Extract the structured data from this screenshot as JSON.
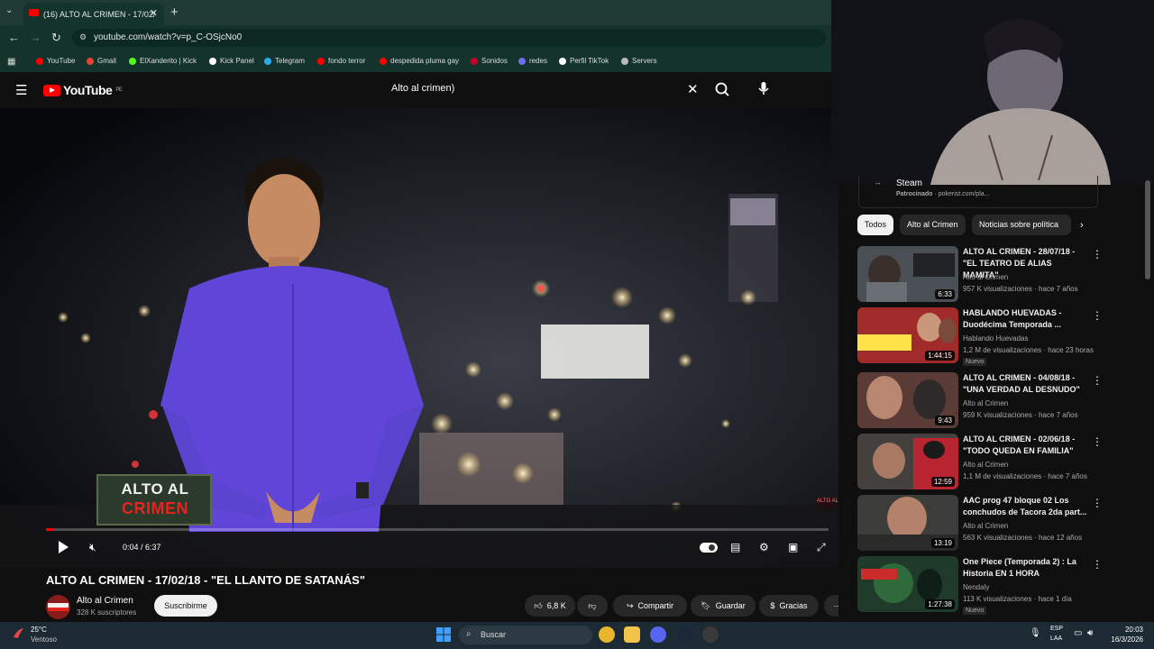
{
  "browser": {
    "tab_title": "(16) ALTO AL CRIMEN - 17/02/",
    "url": "youtube.com/watch?v=p_C-OSjcNo0",
    "bookmarks": [
      {
        "label": "YouTube",
        "color": "#ff0000"
      },
      {
        "label": "Gmail",
        "color": "#ea4335"
      },
      {
        "label": "ElXanderito | Kick",
        "color": "#53fc18"
      },
      {
        "label": "Kick Panel",
        "color": "#ffffff"
      },
      {
        "label": "Telegram",
        "color": "#2aabee"
      },
      {
        "label": "fondo terror",
        "color": "#ff0000"
      },
      {
        "label": "despedida pluma gay",
        "color": "#ff0000"
      },
      {
        "label": "Sonidos",
        "color": "#c4002b"
      },
      {
        "label": "redes",
        "color": "#6f6cf0"
      },
      {
        "label": "Perfil TikTok",
        "color": "#ffffff"
      },
      {
        "label": "Servers",
        "color": "#bbbbbb"
      }
    ]
  },
  "youtube": {
    "logo_text": "YouTube",
    "region": "PE",
    "search_value": "Alto al crimen)"
  },
  "player": {
    "time": "0:04 / 6:37",
    "progress": 0.01,
    "overlay_logo_line1": "ALTO AL",
    "overlay_logo_line2": "CRIMEN",
    "watermark": "ALTO AL"
  },
  "video": {
    "title": "ALTO AL CRIMEN - 17/02/18 - \"EL LLANTO DE SATANÁS\"",
    "channel": "Alto al Crimen",
    "subscribers": "328 K suscriptores",
    "subscribe_label": "Suscribirme",
    "likes": "6,8 K",
    "share_label": "Compartir",
    "save_label": "Guardar",
    "thanks_label": "Gracias"
  },
  "sidebar": {
    "ad": {
      "title": "Steam",
      "sponsor_label": "Patrocinado",
      "sponsor_url": "pokerist.com/pla..."
    },
    "chips": [
      "Todos",
      "Alto al Crimen",
      "Noticias sobre política"
    ],
    "recommendations": [
      {
        "title": "ALTO AL CRIMEN - 28/07/18 - \"EL TEATRO DE ALIAS MAMITA\"",
        "channel": "Alto al Crimen",
        "meta": "957 K visualizaciones · hace 7 años",
        "duration": "6:33",
        "badge": ""
      },
      {
        "title": "HABLANDO HUEVADAS - Duodécima Temporada ...",
        "channel": "Hablando Huevadas",
        "meta": "1,2 M de visualizaciones · hace 23 horas",
        "duration": "1:44:15",
        "badge": "Nuevo"
      },
      {
        "title": "ALTO AL CRIMEN - 04/08/18 - \"UNA VERDAD AL DESNUDO\"",
        "channel": "Alto al Crimen",
        "meta": "959 K visualizaciones · hace 7 años",
        "duration": "9:43",
        "badge": ""
      },
      {
        "title": "ALTO AL CRIMEN - 02/06/18 - \"TODO QUEDA EN FAMILIA\"",
        "channel": "Alto al Crimen",
        "meta": "1,1 M de visualizaciones · hace 7 años",
        "duration": "12:59",
        "badge": ""
      },
      {
        "title": "AAC prog 47 bloque 02 Los conchudos de Tacora 2da part...",
        "channel": "Alto al Crimen",
        "meta": "563 K visualizaciones · hace 12 años",
        "duration": "13:19",
        "badge": ""
      },
      {
        "title": "One Piece (Temporada 2) : La Historia EN 1 HORA",
        "channel": "Nendaly",
        "meta": "113 K visualizaciones · hace 1 día",
        "duration": "1:27:38",
        "badge": "Nuevo"
      }
    ]
  },
  "taskbar": {
    "temperature": "25°C",
    "weather": "Ventoso",
    "search_label": "Buscar",
    "lang1": "ESP",
    "lang2": "LAA",
    "time": "20:03",
    "date": "16/3/2026"
  }
}
